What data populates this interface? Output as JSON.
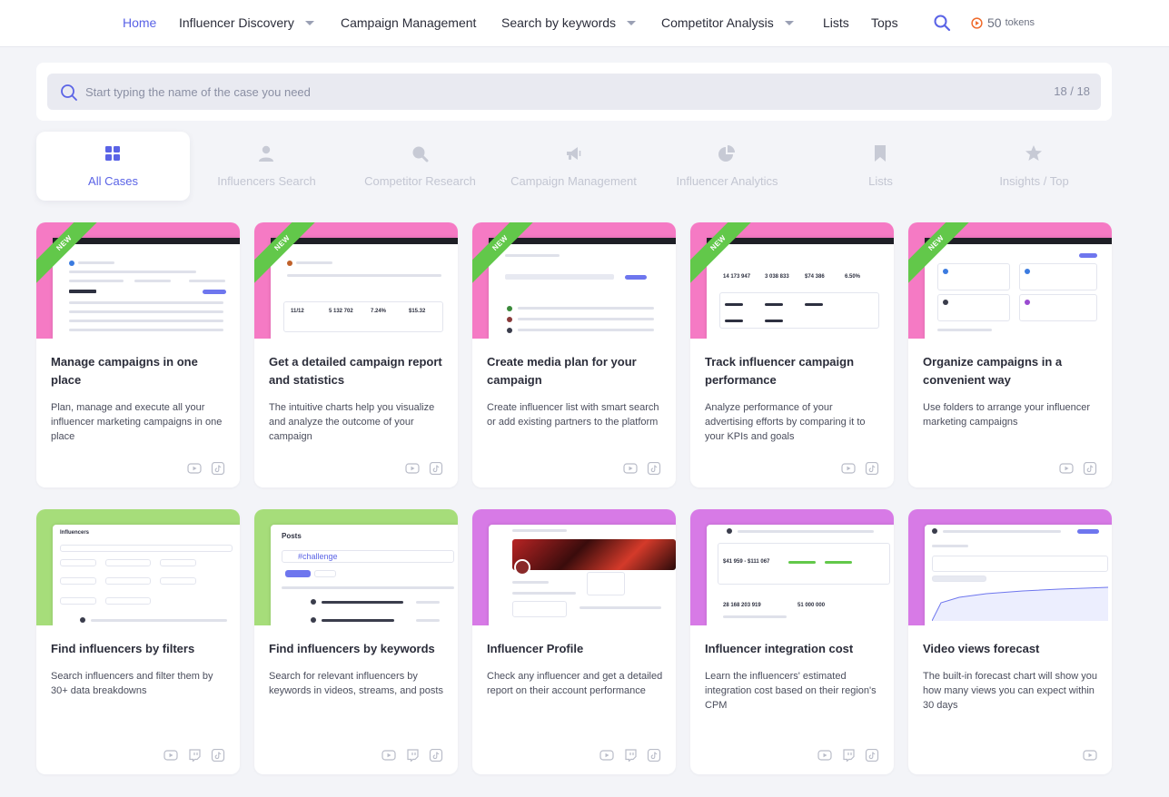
{
  "nav": {
    "items": [
      {
        "label": "Home",
        "active": true,
        "dropdown": false
      },
      {
        "label": "Influencer Discovery",
        "active": false,
        "dropdown": true
      },
      {
        "label": "Campaign Management",
        "active": false,
        "dropdown": false
      },
      {
        "label": "Search by keywords",
        "active": false,
        "dropdown": true
      },
      {
        "label": "Competitor Analysis",
        "active": false,
        "dropdown": true
      },
      {
        "label": "Lists",
        "active": false,
        "dropdown": false
      },
      {
        "label": "Tops",
        "active": false,
        "dropdown": false
      }
    ],
    "search_icon": "search-icon",
    "tokens_count": "50",
    "tokens_label": "tokens"
  },
  "search": {
    "placeholder": "Start typing the name of the case you need",
    "value": "",
    "count": "18 / 18"
  },
  "categories": [
    {
      "label": "All Cases",
      "icon": "grid-icon",
      "active": true
    },
    {
      "label": "Influencers Search",
      "icon": "user-icon",
      "active": false
    },
    {
      "label": "Competitor Research",
      "icon": "search-icon",
      "active": false
    },
    {
      "label": "Campaign Management",
      "icon": "megaphone-icon",
      "active": false
    },
    {
      "label": "Influencer Analytics",
      "icon": "pie-chart-icon",
      "active": false
    },
    {
      "label": "Lists",
      "icon": "bookmark-icon",
      "active": false
    },
    {
      "label": "Insights / Top",
      "icon": "star-icon",
      "active": false
    }
  ],
  "cards": [
    {
      "title": "Manage campaigns in one place",
      "desc": "Plan, manage and execute all your influencer marketing campaigns in one place",
      "badge": "NEW",
      "thumb_color": "#f57ac4",
      "platforms": [
        "youtube",
        "tiktok"
      ]
    },
    {
      "title": "Get a detailed campaign report and statistics",
      "desc": "The intuitive charts help you visualize and analyze the outcome of your campaign",
      "badge": "NEW",
      "thumb_color": "#f57ac4",
      "platforms": [
        "youtube",
        "tiktok"
      ]
    },
    {
      "title": "Create media plan for your campaign",
      "desc": "Create influencer list with smart search or add existing partners to the platform",
      "badge": "NEW",
      "thumb_color": "#f57ac4",
      "platforms": [
        "youtube",
        "tiktok"
      ]
    },
    {
      "title": "Track influencer campaign performance",
      "desc": "Analyze performance of your advertising efforts by comparing it to your KPIs and goals",
      "badge": "NEW",
      "thumb_color": "#f57ac4",
      "platforms": [
        "youtube",
        "tiktok"
      ]
    },
    {
      "title": "Organize campaigns in a convenient way",
      "desc": "Use folders to arrange your influencer marketing campaigns",
      "badge": "NEW",
      "thumb_color": "#f57ac4",
      "platforms": [
        "youtube",
        "tiktok"
      ]
    },
    {
      "title": "Find influencers by filters",
      "desc": "Search influencers and filter them by 30+ data breakdowns",
      "badge": "",
      "thumb_color": "#a6dd7a",
      "platforms": [
        "youtube",
        "twitch",
        "tiktok"
      ]
    },
    {
      "title": "Find influencers by keywords",
      "desc": "Search for relevant influencers by keywords in videos, streams, and posts",
      "badge": "",
      "thumb_color": "#a6dd7a",
      "platforms": [
        "youtube",
        "twitch",
        "tiktok"
      ]
    },
    {
      "title": "Influencer Profile",
      "desc": "Check any influencer and get a detailed report on their account performance",
      "badge": "",
      "thumb_color": "#d77ae6",
      "platforms": [
        "youtube",
        "twitch",
        "tiktok"
      ]
    },
    {
      "title": "Influencer integration cost",
      "desc": "Learn the influencers' estimated integration cost based on their region's CPM",
      "badge": "",
      "thumb_color": "#d77ae6",
      "platforms": [
        "youtube",
        "twitch",
        "tiktok"
      ]
    },
    {
      "title": "Video views forecast",
      "desc": "The built-in forecast chart will show you how many views you can expect within 30 days",
      "badge": "",
      "thumb_color": "#d77ae6",
      "platforms": [
        "youtube"
      ]
    }
  ],
  "thumb_text": {
    "posts_title": "Posts",
    "posts_query": "#challenge",
    "influencers_title": "Influencers",
    "kpi_a": "11/12",
    "kpi_b": "5 132 702",
    "kpi_c": "7.24%",
    "kpi_d": "$15.32",
    "track_a": "14 173 947",
    "track_b": "3 038 833",
    "track_c": "$74 386",
    "track_d": "6.50%",
    "cost_range": "$41 959 - $111 067",
    "forecast_a": "28 168 203 919",
    "forecast_b": "51 000 000"
  }
}
